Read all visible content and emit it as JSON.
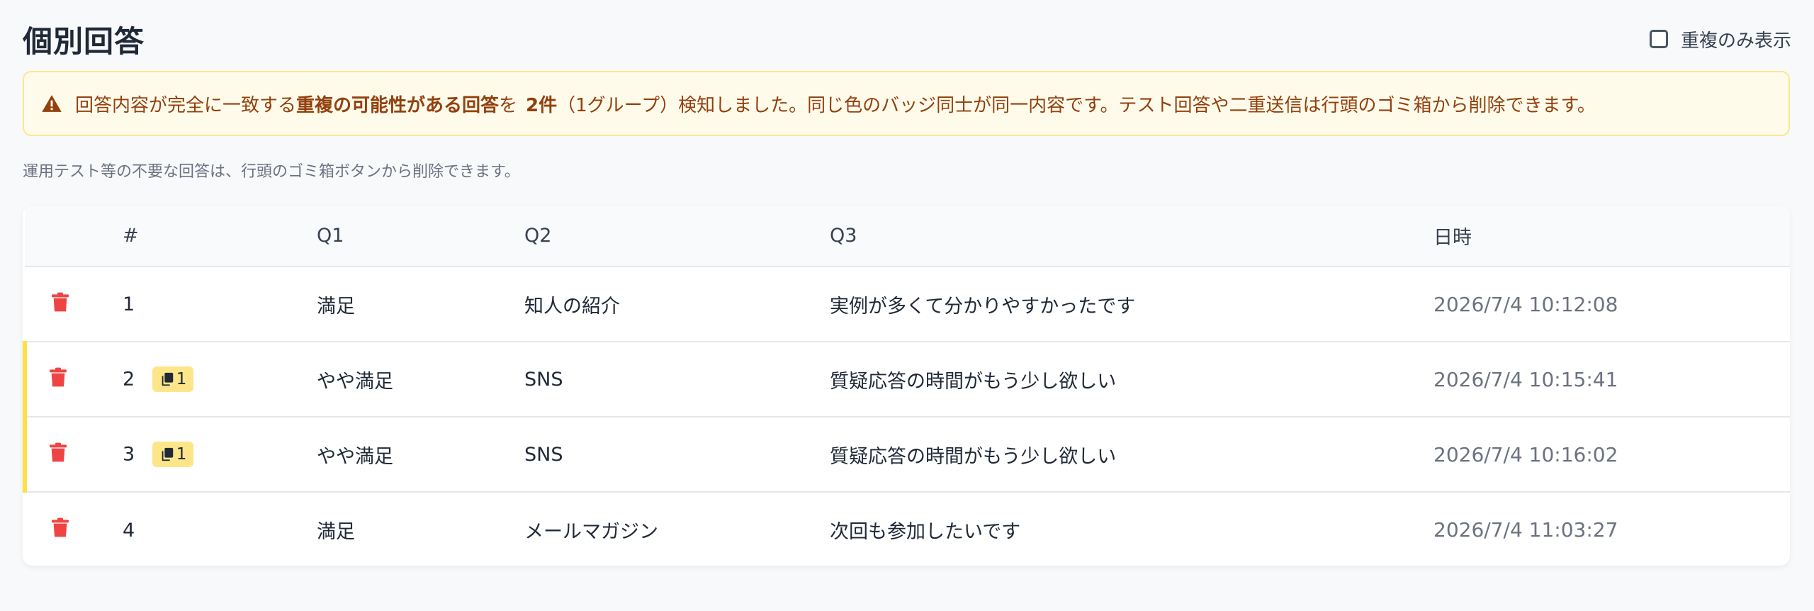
{
  "header": {
    "title": "個別回答",
    "toggle_label": "重複のみ表示"
  },
  "alert": {
    "text_before": "回答内容が完全に一致する",
    "text_bold": "重複の可能性がある回答",
    "text_middle": "を",
    "count": "2件",
    "text_after": "（1グループ）検知しました。同じ色のバッジ同士が同一内容です。テスト回答や二重送信は行頭のゴミ箱から削除できます。"
  },
  "note": "運用テスト等の不要な回答は、行頭のゴミ箱ボタンから削除できます。",
  "table": {
    "columns": [
      "#",
      "Q1",
      "Q2",
      "Q3",
      "日時"
    ],
    "rows": [
      {
        "num": "1",
        "badge": "",
        "q1": "満足",
        "q2": "知人の紹介",
        "q3": "実例が多くて分かりやすかったです",
        "date": "2026/7/4 10:12:08"
      },
      {
        "num": "2",
        "badge": "1",
        "q1": "やや満足",
        "q2": "SNS",
        "q3": "質疑応答の時間がもう少し欲しい",
        "date": "2026/7/4 10:15:41"
      },
      {
        "num": "3",
        "badge": "1",
        "q1": "やや満足",
        "q2": "SNS",
        "q3": "質疑応答の時間がもう少し欲しい",
        "date": "2026/7/4 10:16:02"
      },
      {
        "num": "4",
        "badge": "",
        "q1": "満足",
        "q2": "メールマガジン",
        "q3": "次回も参加したいです",
        "date": "2026/7/4 11:03:27"
      }
    ]
  },
  "colors": {
    "alert_bg": "#fffbeb",
    "alert_border": "#fde68a",
    "alert_text": "#92400e",
    "trash": "#ef4444",
    "dup_badge_bg": "#fde68a",
    "dup_row_marker": "#fde047"
  },
  "icons": {
    "alert": "warning-triangle-icon",
    "delete": "trash-icon",
    "duplicate": "copy-icon"
  }
}
